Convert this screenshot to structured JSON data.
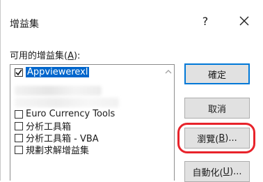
{
  "dialog": {
    "title": "增益集",
    "help_label": "?",
    "close_icon": "close-icon"
  },
  "list": {
    "label_prefix": "可用的增益集(",
    "label_hotkey": "A",
    "label_suffix": "):",
    "items": [
      {
        "label": "Appviewerexl",
        "checked": true,
        "selected": true
      },
      {
        "label": "Euro Currency Tools",
        "checked": false,
        "selected": false
      },
      {
        "label": "分析工具箱",
        "checked": false,
        "selected": false
      },
      {
        "label": "分析工具箱 - VBA",
        "checked": false,
        "selected": false
      },
      {
        "label": "規劃求解增益集",
        "checked": false,
        "selected": false
      }
    ]
  },
  "buttons": {
    "ok": "確定",
    "cancel": "取消",
    "browse_prefix": "瀏覽(",
    "browse_hotkey": "B",
    "browse_suffix": ")...",
    "automation_prefix": "自動化(",
    "automation_hotkey": "U",
    "automation_suffix": ")..."
  },
  "colors": {
    "selection": "#0066cc",
    "highlight_ring": "#e8232b",
    "default_button_border": "#0078d7"
  }
}
